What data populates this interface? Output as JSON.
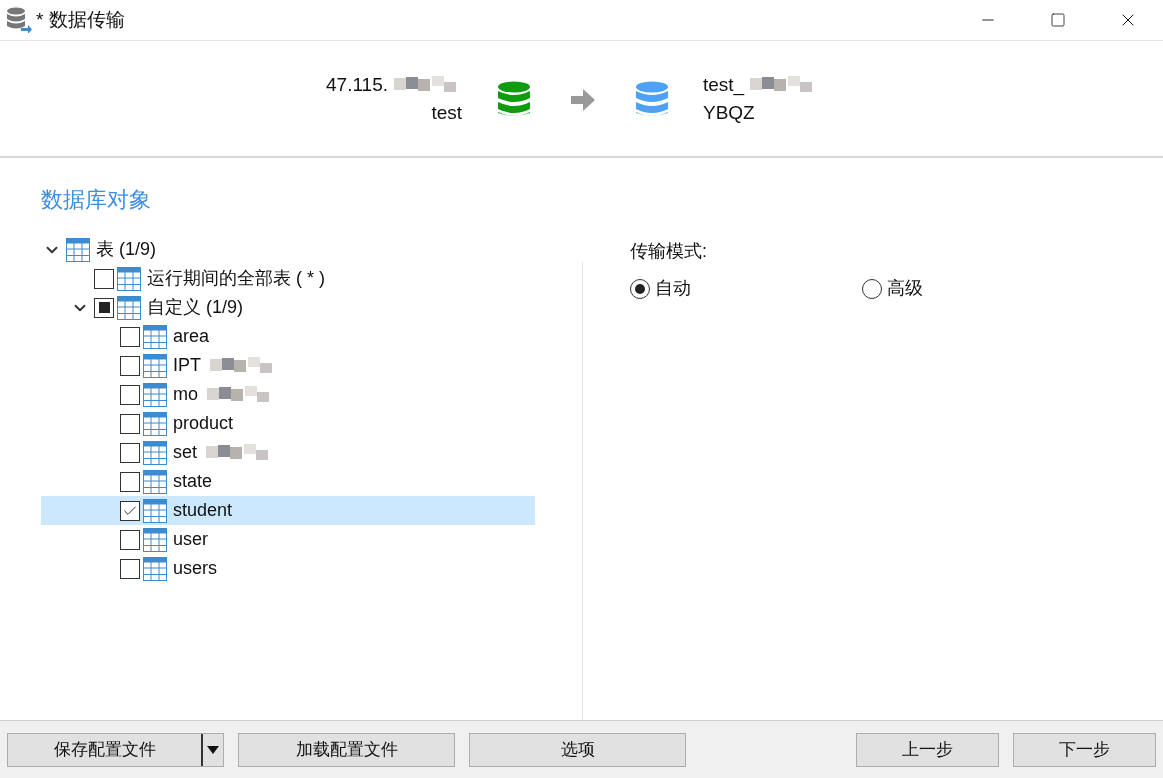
{
  "window": {
    "title": "* 数据传输"
  },
  "header": {
    "source": {
      "host": "47.115.",
      "database": "test"
    },
    "target": {
      "host": "test_",
      "database": "YBQZ"
    }
  },
  "objects": {
    "title": "数据库对象",
    "tree": [
      {
        "label": "表 (1/9)",
        "expanded": true,
        "children": [
          {
            "label": "运行期间的全部表 ( * )",
            "checked": false,
            "mixed": false,
            "selected": false
          },
          {
            "label": "自定义 (1/9)",
            "checked": false,
            "mixed": true,
            "expanded": true,
            "selected": false,
            "children": [
              {
                "label": "area",
                "checked": false,
                "selected": false
              },
              {
                "label": "IPT",
                "checked": false,
                "selected": false,
                "redacted": true
              },
              {
                "label": "mo",
                "checked": false,
                "selected": false,
                "redacted": true
              },
              {
                "label": "product",
                "checked": false,
                "selected": false
              },
              {
                "label": "set",
                "checked": false,
                "selected": false,
                "redacted": true
              },
              {
                "label": "state",
                "checked": false,
                "selected": false
              },
              {
                "label": "student",
                "checked": true,
                "selected": true
              },
              {
                "label": "user",
                "checked": false,
                "selected": false
              },
              {
                "label": "users",
                "checked": false,
                "selected": false
              }
            ]
          }
        ]
      }
    ]
  },
  "transfer_mode": {
    "label": "传输模式:",
    "options": [
      {
        "label": "自动",
        "selected": true
      },
      {
        "label": "高级",
        "selected": false
      }
    ]
  },
  "footer": {
    "left_buttons": [
      {
        "label": "保存配置文件",
        "kind": "split"
      },
      {
        "label": "加载配置文件",
        "kind": "plain"
      },
      {
        "label": "选项",
        "kind": "plain"
      }
    ],
    "right_buttons": [
      {
        "label": "上一步",
        "kind": "plain"
      },
      {
        "label": "下一步",
        "kind": "plain"
      }
    ]
  }
}
